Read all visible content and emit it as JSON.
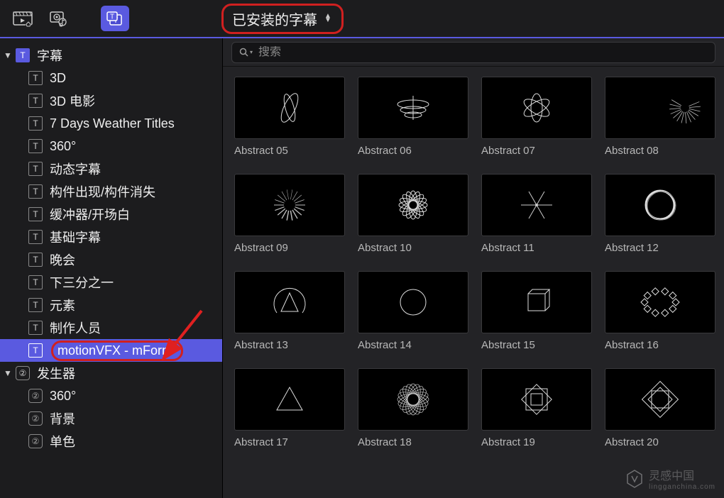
{
  "topbar": {
    "dropdown_label": "已安装的字幕"
  },
  "search": {
    "placeholder": "搜索"
  },
  "sidebar": {
    "categories": [
      {
        "label": "字幕",
        "icon": "T",
        "items": [
          {
            "label": "3D"
          },
          {
            "label": "3D 电影"
          },
          {
            "label": "7 Days Weather Titles"
          },
          {
            "label": "360°"
          },
          {
            "label": "动态字幕"
          },
          {
            "label": "构件出现/构件消失"
          },
          {
            "label": "缓冲器/开场白"
          },
          {
            "label": "基础字幕"
          },
          {
            "label": "晚会"
          },
          {
            "label": "下三分之一"
          },
          {
            "label": "元素"
          },
          {
            "label": "制作人员"
          },
          {
            "label": "motionVFX - mForm",
            "selected": true,
            "highlighted": true
          }
        ]
      },
      {
        "label": "发生器",
        "icon": "②",
        "items": [
          {
            "label": "360°"
          },
          {
            "label": "背景"
          },
          {
            "label": "单色"
          }
        ]
      }
    ]
  },
  "grid": {
    "items": [
      {
        "label": "Abstract 05",
        "shape": "leaf"
      },
      {
        "label": "Abstract 06",
        "shape": "spiral"
      },
      {
        "label": "Abstract 07",
        "shape": "atom"
      },
      {
        "label": "Abstract 08",
        "shape": "burst"
      },
      {
        "label": "Abstract 09",
        "shape": "radial"
      },
      {
        "label": "Abstract 10",
        "shape": "spiro"
      },
      {
        "label": "Abstract 11",
        "shape": "star6"
      },
      {
        "label": "Abstract 12",
        "shape": "ring"
      },
      {
        "label": "Abstract 13",
        "shape": "arc-tri"
      },
      {
        "label": "Abstract 14",
        "shape": "circle"
      },
      {
        "label": "Abstract 15",
        "shape": "square3d"
      },
      {
        "label": "Abstract 16",
        "shape": "gems"
      },
      {
        "label": "Abstract 17",
        "shape": "triangle"
      },
      {
        "label": "Abstract 18",
        "shape": "rosette"
      },
      {
        "label": "Abstract 19",
        "shape": "diamond-sq"
      },
      {
        "label": "Abstract 20",
        "shape": "diamond-sq2"
      }
    ]
  },
  "watermark": {
    "main": "灵感中国",
    "sub": "lingganchina.com"
  }
}
